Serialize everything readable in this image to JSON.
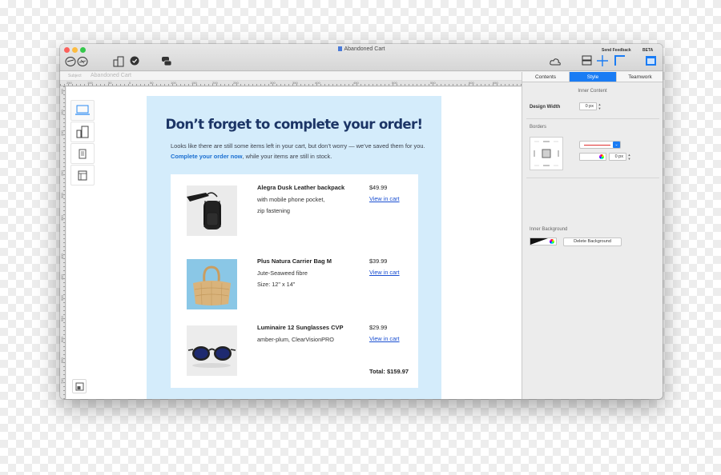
{
  "window": {
    "title": "Abandoned Cart",
    "send_feedback": "Send Feedback",
    "beta": "BETA"
  },
  "subject": {
    "label": "Subject",
    "value": "Abandoned Cart"
  },
  "rulers": {
    "horizontal": [
      "250",
      "100",
      "50",
      "0",
      "50",
      "100",
      "150",
      "200",
      "250",
      "300",
      "350",
      "400",
      "450",
      "500",
      "550",
      "600",
      "650"
    ],
    "vertical": [
      "100",
      "150",
      "200",
      "250",
      "300",
      "350",
      "400",
      "450",
      "500",
      "550",
      "600",
      "650",
      "700",
      "750"
    ]
  },
  "email": {
    "heading": "Don’t forget to complete your order!",
    "body_before": "Looks like there are still some items left in your cart, but don’t worry — we’ve saved them for you. ",
    "body_link": "Complete your order now",
    "body_after": ", while your items are still in stock.",
    "items": [
      {
        "name": "Alegra Dusk Leather backpack",
        "desc_lines": [
          "with mobile phone pocket,",
          "zip fastening"
        ],
        "price": "$49.99",
        "link": "View in cart",
        "image": "backpack"
      },
      {
        "name": "Plus Natura Carrier Bag M",
        "desc_lines": [
          "Jute-Seaweed fibre",
          "Size: 12\" x 14\""
        ],
        "price": "$39.99",
        "link": "View in cart",
        "image": "straw-bag"
      },
      {
        "name": "Luminaire 12 Sunglasses CVP",
        "desc_lines": [
          "amber-plum, ClearVisionPRO"
        ],
        "price": "$29.99",
        "link": "View in cart",
        "image": "sunglasses"
      }
    ],
    "total": "Total: $159.97",
    "colors": {
      "background": "#d4ecfb",
      "heading": "#1c3566",
      "link": "#1a6fd1"
    }
  },
  "panel": {
    "tabs": [
      {
        "label": "Contents",
        "active": false
      },
      {
        "label": "Style",
        "active": true
      },
      {
        "label": "Teamwork",
        "active": false
      }
    ],
    "inner_content_title": "Inner Content",
    "design_width_label": "Design Width",
    "design_width_value": "0 px",
    "borders_title": "Borders",
    "border_width_value": "0 px",
    "inner_background_title": "Inner Background",
    "delete_background_label": "Delete Background",
    "accent_color": "#1a7cf4"
  },
  "icons": [
    "stamp-icon",
    "device-icon",
    "check-circle-icon",
    "chat-icon",
    "cloud-icon",
    "layout-icon",
    "crosshair-icon",
    "corner-icon",
    "sidebar-icon"
  ]
}
